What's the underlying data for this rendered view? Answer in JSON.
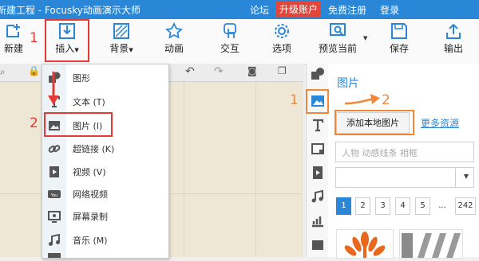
{
  "titlebar": {
    "title": "新建工程 - Focusky动画演示大师",
    "forum": "论坛",
    "upgrade": "升级账户",
    "register": "免费注册",
    "login": "登录"
  },
  "toolbar": {
    "new": "新建",
    "insert": "插入",
    "background": "背景",
    "animation": "动画",
    "interaction": "交互",
    "options": "选项",
    "preview": "预览当前",
    "save": "保存",
    "export": "输出"
  },
  "menu": {
    "items": [
      {
        "label": "图形",
        "icon": "shape-icon"
      },
      {
        "label": "文本 (T)",
        "icon": "text-icon"
      },
      {
        "label": "图片 (I)",
        "icon": "image-icon"
      },
      {
        "label": "超链接 (K)",
        "icon": "link-icon"
      },
      {
        "label": "视频 (V)",
        "icon": "video-icon"
      },
      {
        "label": "网络视频",
        "icon": "youtube-icon"
      },
      {
        "label": "屏幕录制",
        "icon": "screen-record-icon"
      },
      {
        "label": "音乐 (M)",
        "icon": "music-icon"
      }
    ]
  },
  "panel": {
    "title": "图片",
    "add_local": "添加本地图片",
    "more": "更多资源",
    "search_placeholder": "人物 动感线条 相框",
    "pages": [
      "1",
      "2",
      "3",
      "4",
      "5",
      "...",
      "242"
    ],
    "current_page": "1"
  },
  "annotations": {
    "step1_toolbar": "1",
    "step2_menu": "2",
    "step1_panel": "1",
    "step2_panel": "2"
  },
  "colors": {
    "titlebar": "#2a87d8",
    "upgrade": "#e1463b",
    "accent": "#2a87d8",
    "annotation_red": "#e53935",
    "annotation_orange": "#f0883a",
    "canvas": "#eee7d6"
  }
}
